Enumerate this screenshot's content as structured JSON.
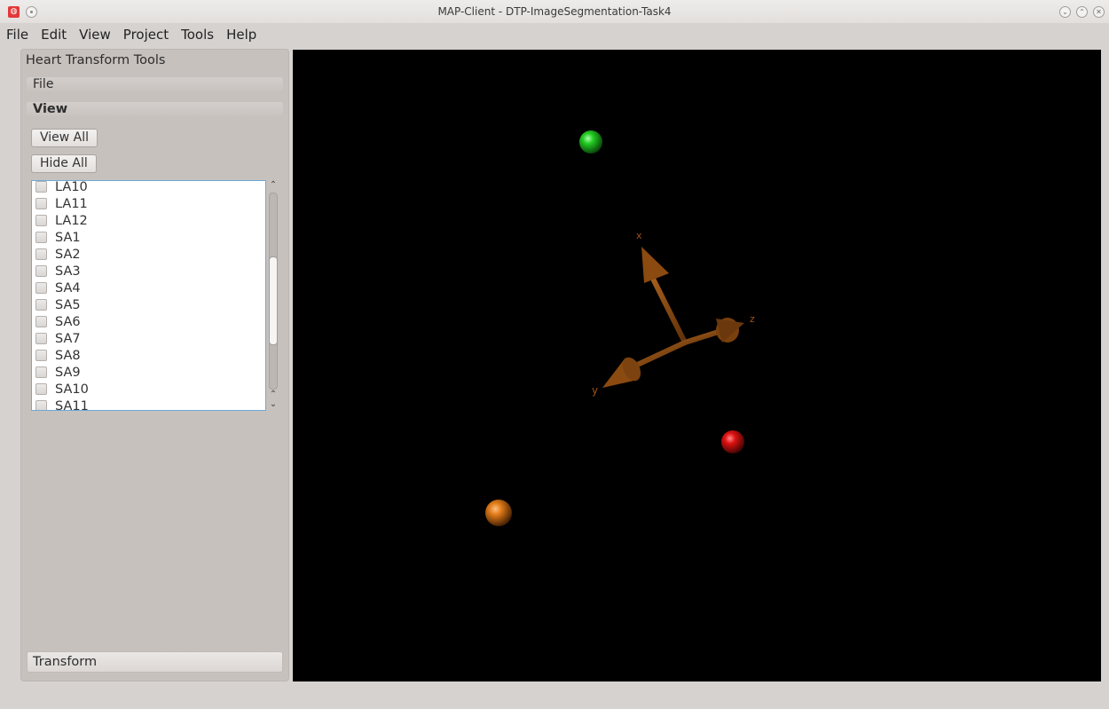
{
  "window": {
    "title": "MAP-Client - DTP-ImageSegmentation-Task4",
    "controls": [
      "minimize",
      "maximize",
      "close"
    ]
  },
  "menubar": {
    "items": [
      "File",
      "Edit",
      "View",
      "Project",
      "Tools",
      "Help"
    ]
  },
  "panel": {
    "title": "Heart Transform Tools",
    "sections": {
      "file": "File",
      "view": "View"
    },
    "buttons": {
      "view_all": "View All",
      "hide_all": "Hide All"
    },
    "list_items": [
      "LA10",
      "LA11",
      "LA12",
      "SA1",
      "SA2",
      "SA3",
      "SA4",
      "SA5",
      "SA6",
      "SA7",
      "SA8",
      "SA9",
      "SA10",
      "SA11"
    ],
    "transform_label": "Transform"
  },
  "viewport": {
    "axis_labels": {
      "x": "x",
      "y": "y",
      "z": "z"
    },
    "colors": {
      "background": "#000000",
      "axes": "#8a4a10",
      "marker_green": "#22cc22",
      "marker_red": "#dd1111",
      "marker_orange": "#e07a18"
    }
  }
}
